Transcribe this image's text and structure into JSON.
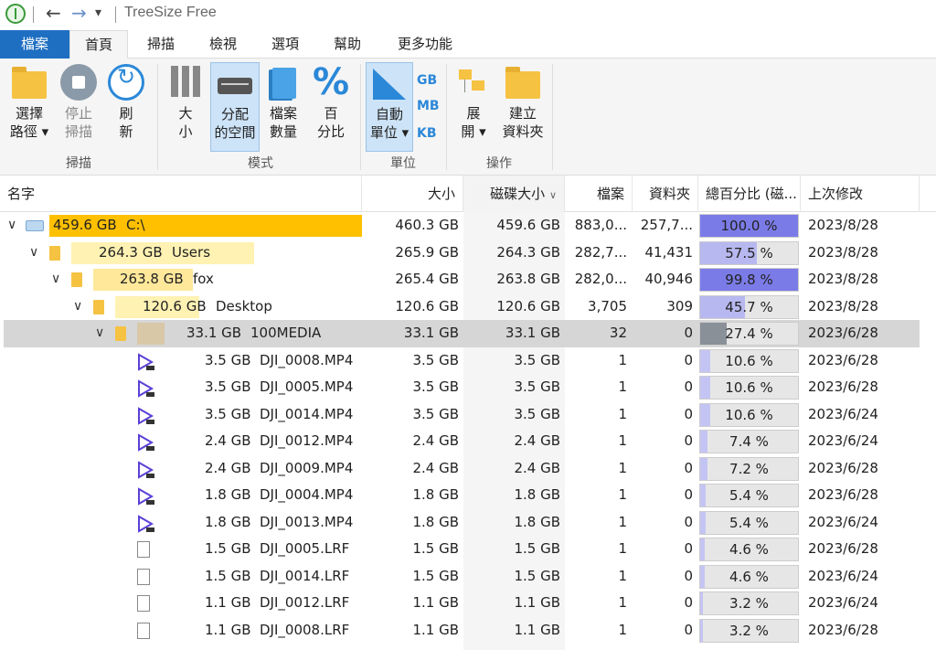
{
  "app": {
    "title": "TreeSize Free"
  },
  "tabs": [
    {
      "label": "檔案"
    },
    {
      "label": "首頁"
    },
    {
      "label": "掃描"
    },
    {
      "label": "檢視"
    },
    {
      "label": "選項"
    },
    {
      "label": "幫助"
    },
    {
      "label": "更多功能"
    }
  ],
  "ribbon": {
    "select_path": "選擇\n路徑 ▾",
    "stop_scan": "停止\n掃描",
    "refresh": "刷\n新",
    "size": "大\n小",
    "allocated": "分配\n的空間",
    "file_count": "檔案\n數量",
    "percent": "百\n分比",
    "auto_unit": "自動\n單位 ▾",
    "unit_gb": "GB",
    "unit_mb": "MB",
    "unit_kb": "KB",
    "expand": "展\n開 ▾",
    "new_folder": "建立\n資料夾",
    "group_scan": "掃描",
    "group_mode": "模式",
    "group_unit": "單位",
    "group_ops": "操作"
  },
  "columns": {
    "name": "名字",
    "size": "大小",
    "disk_size": "磁碟大小",
    "files": "檔案",
    "folders": "資料夾",
    "percent": "總百分比 (磁...",
    "modified": "上次修改"
  },
  "colors": {
    "accent": "#1e6fc2",
    "bar_gold": "#ffc000",
    "bar_light": "#fff2b3",
    "pct_fill": "#7b7be8",
    "pct_fill_light": "#c4c4f4",
    "selected": "#d6d6d6"
  },
  "rows": [
    {
      "level": 0,
      "icon": "drive-icon",
      "bar": "459.6 GB",
      "name": "C:\\",
      "size": "460.3 GB",
      "disk": "459.6 GB",
      "files": "883,0...",
      "folders": "257,7...",
      "pct": "100.0 %",
      "pct_val": 100.0,
      "modified": "2023/8/28"
    },
    {
      "level": 1,
      "icon": "folder-icon",
      "bar": "264.3 GB",
      "name": "Users",
      "size": "265.9 GB",
      "disk": "264.3 GB",
      "files": "282,7...",
      "folders": "41,431",
      "pct": "57.5 %",
      "pct_val": 57.5,
      "modified": "2023/8/28"
    },
    {
      "level": 2,
      "icon": "folder-icon",
      "bar": "263.8 GB",
      "name": "fox",
      "size": "265.4 GB",
      "disk": "263.8 GB",
      "files": "282,0...",
      "folders": "40,946",
      "pct": "99.8 %",
      "pct_val": 99.8,
      "modified": "2023/8/28"
    },
    {
      "level": 3,
      "icon": "folder-icon",
      "bar": "120.6 GB",
      "name": "Desktop",
      "size": "120.6 GB",
      "disk": "120.6 GB",
      "files": "3,705",
      "folders": "309",
      "pct": "45.7 %",
      "pct_val": 45.7,
      "modified": "2023/8/28"
    },
    {
      "level": 4,
      "icon": "folder-icon",
      "bar": "33.1 GB",
      "name": "100MEDIA",
      "size": "33.1 GB",
      "disk": "33.1 GB",
      "files": "32",
      "folders": "0",
      "pct": "27.4 %",
      "pct_val": 27.4,
      "modified": "2023/6/28",
      "selected": true
    },
    {
      "level": 5,
      "icon": "video-icon",
      "bar": "3.5 GB",
      "name": "DJI_0008.MP4",
      "size": "3.5 GB",
      "disk": "3.5 GB",
      "files": "1",
      "folders": "0",
      "pct": "10.6 %",
      "pct_val": 10.6,
      "modified": "2023/6/28"
    },
    {
      "level": 5,
      "icon": "video-icon",
      "bar": "3.5 GB",
      "name": "DJI_0005.MP4",
      "size": "3.5 GB",
      "disk": "3.5 GB",
      "files": "1",
      "folders": "0",
      "pct": "10.6 %",
      "pct_val": 10.6,
      "modified": "2023/6/28"
    },
    {
      "level": 5,
      "icon": "video-icon",
      "bar": "3.5 GB",
      "name": "DJI_0014.MP4",
      "size": "3.5 GB",
      "disk": "3.5 GB",
      "files": "1",
      "folders": "0",
      "pct": "10.6 %",
      "pct_val": 10.6,
      "modified": "2023/6/24"
    },
    {
      "level": 5,
      "icon": "video-icon",
      "bar": "2.4 GB",
      "name": "DJI_0012.MP4",
      "size": "2.4 GB",
      "disk": "2.4 GB",
      "files": "1",
      "folders": "0",
      "pct": "7.4 %",
      "pct_val": 7.4,
      "modified": "2023/6/24"
    },
    {
      "level": 5,
      "icon": "video-icon",
      "bar": "2.4 GB",
      "name": "DJI_0009.MP4",
      "size": "2.4 GB",
      "disk": "2.4 GB",
      "files": "1",
      "folders": "0",
      "pct": "7.2 %",
      "pct_val": 7.2,
      "modified": "2023/6/28"
    },
    {
      "level": 5,
      "icon": "video-icon",
      "bar": "1.8 GB",
      "name": "DJI_0004.MP4",
      "size": "1.8 GB",
      "disk": "1.8 GB",
      "files": "1",
      "folders": "0",
      "pct": "5.4 %",
      "pct_val": 5.4,
      "modified": "2023/6/28"
    },
    {
      "level": 5,
      "icon": "video-icon",
      "bar": "1.8 GB",
      "name": "DJI_0013.MP4",
      "size": "1.8 GB",
      "disk": "1.8 GB",
      "files": "1",
      "folders": "0",
      "pct": "5.4 %",
      "pct_val": 5.4,
      "modified": "2023/6/24"
    },
    {
      "level": 5,
      "icon": "file-icon",
      "bar": "1.5 GB",
      "name": "DJI_0005.LRF",
      "size": "1.5 GB",
      "disk": "1.5 GB",
      "files": "1",
      "folders": "0",
      "pct": "4.6 %",
      "pct_val": 4.6,
      "modified": "2023/6/28"
    },
    {
      "level": 5,
      "icon": "file-icon",
      "bar": "1.5 GB",
      "name": "DJI_0014.LRF",
      "size": "1.5 GB",
      "disk": "1.5 GB",
      "files": "1",
      "folders": "0",
      "pct": "4.6 %",
      "pct_val": 4.6,
      "modified": "2023/6/24"
    },
    {
      "level": 5,
      "icon": "file-icon",
      "bar": "1.1 GB",
      "name": "DJI_0012.LRF",
      "size": "1.1 GB",
      "disk": "1.1 GB",
      "files": "1",
      "folders": "0",
      "pct": "3.2 %",
      "pct_val": 3.2,
      "modified": "2023/6/24"
    },
    {
      "level": 5,
      "icon": "file-icon",
      "bar": "1.1 GB",
      "name": "DJI_0008.LRF",
      "size": "1.1 GB",
      "disk": "1.1 GB",
      "files": "1",
      "folders": "0",
      "pct": "3.2 %",
      "pct_val": 3.2,
      "modified": "2023/6/28"
    }
  ]
}
